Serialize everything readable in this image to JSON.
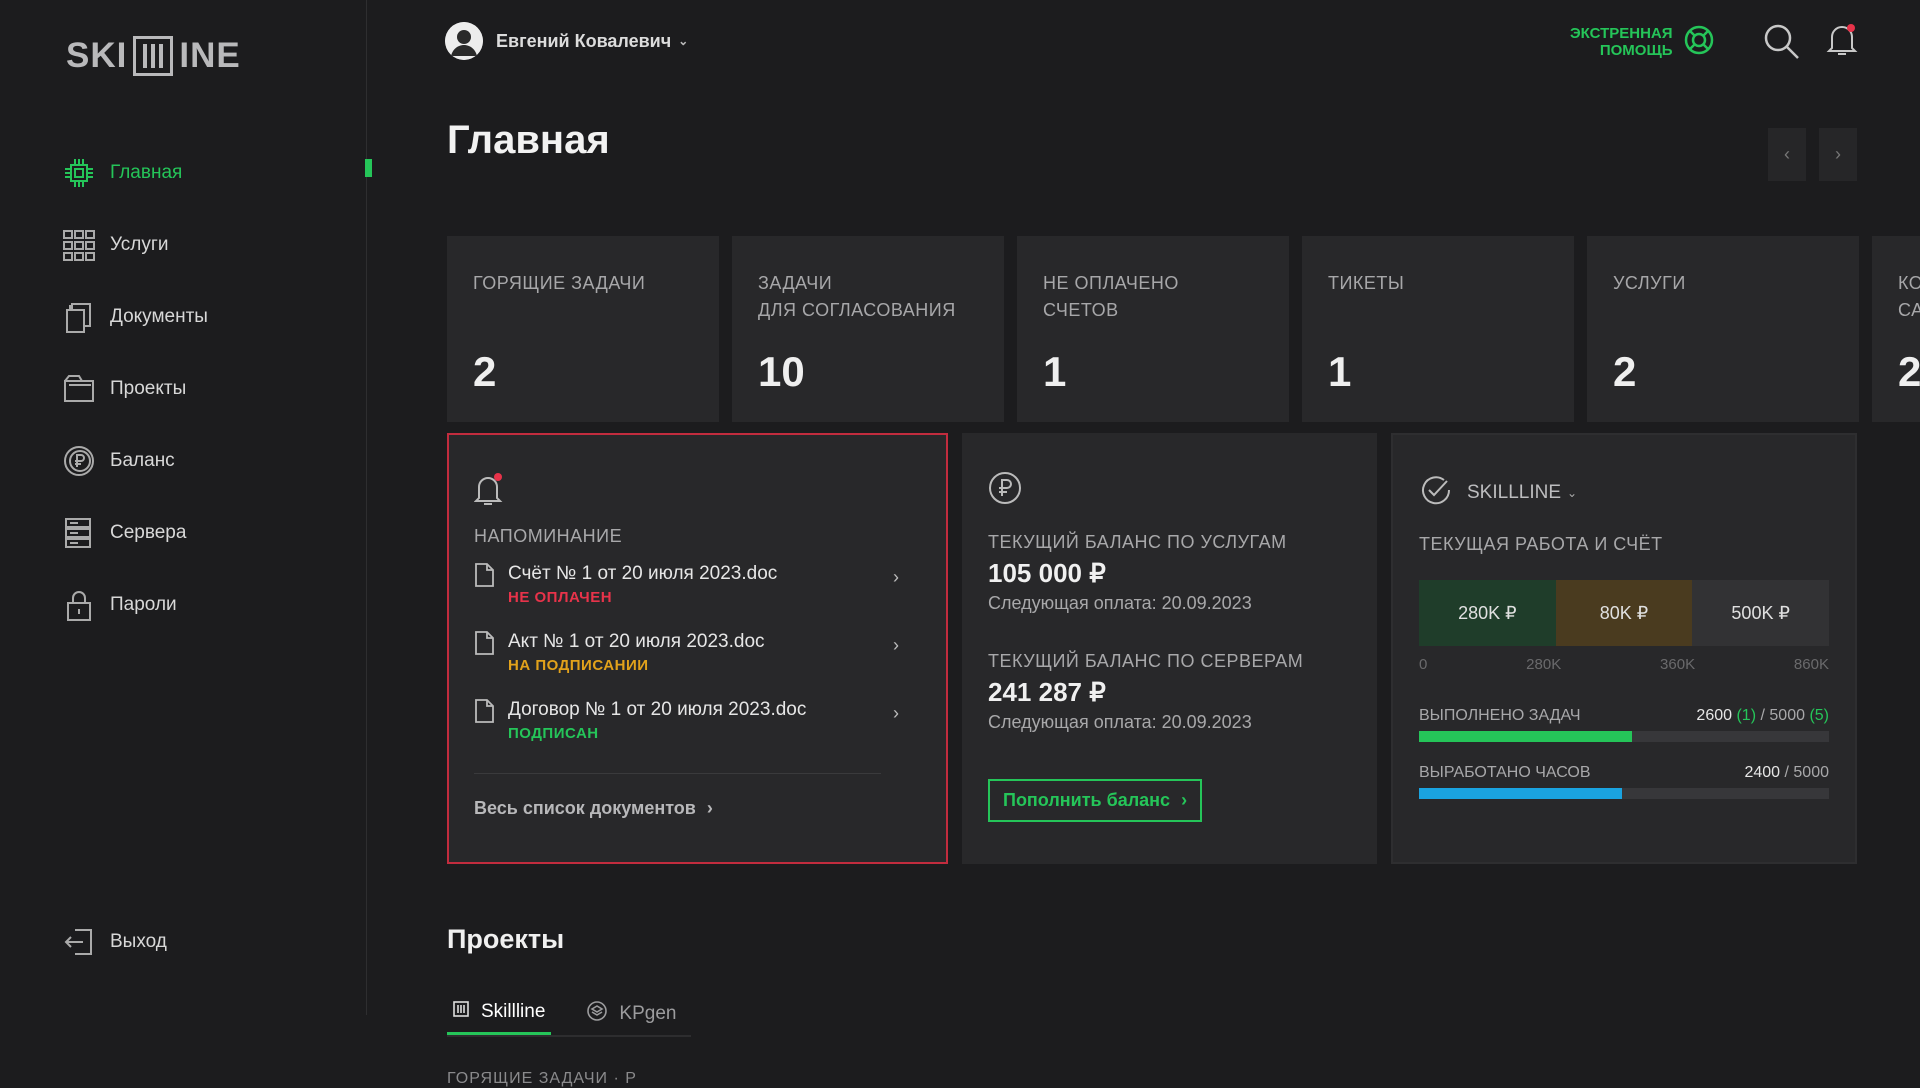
{
  "app": {
    "logo": "SKI",
    "logo_tail": "INE"
  },
  "sidebar": {
    "items": [
      {
        "label": "Главная",
        "icon": "chip-icon",
        "active": true
      },
      {
        "label": "Услуги",
        "icon": "grid-icon"
      },
      {
        "label": "Документы",
        "icon": "documents-icon"
      },
      {
        "label": "Проекты",
        "icon": "folder-icon"
      },
      {
        "label": "Баланс",
        "icon": "ruble-coin-icon"
      },
      {
        "label": "Сервера",
        "icon": "server-icon"
      },
      {
        "label": "Пароли",
        "icon": "lock-icon"
      }
    ],
    "logout": "Выход"
  },
  "header": {
    "user_name": "Евгений Ковалевич",
    "emergency_line1": "ЭКСТРЕННАЯ",
    "emergency_line2": "ПОМОЩЬ"
  },
  "page": {
    "title": "Главная",
    "prev": "‹",
    "next": "›"
  },
  "stats": [
    {
      "label1": "ГОРЯЩИЕ ЗАДАЧИ",
      "label2": "",
      "value": "2"
    },
    {
      "label1": "ЗАДАЧИ",
      "label2": "ДЛЯ СОГЛАСОВАНИЯ",
      "value": "10"
    },
    {
      "label1": "НЕ ОПЛАЧЕНО",
      "label2": "СЧЕТОВ",
      "value": "1"
    },
    {
      "label1": "ТИКЕТЫ",
      "label2": "",
      "value": "1"
    },
    {
      "label1": "УСЛУГИ",
      "label2": "",
      "value": "2"
    },
    {
      "label1": "КО",
      "label2": "СА",
      "value": "2"
    }
  ],
  "reminder": {
    "title": "НАПОМИНАНИЕ",
    "docs": [
      {
        "name": "Счёт № 1 от 20 июля 2023.doc",
        "status": "НЕ ОПЛАЧЕН",
        "color": "#e8334a"
      },
      {
        "name": "Акт № 1 от 20 июля 2023.doc",
        "status": "НА ПОДПИСАНИИ",
        "color": "#e2a21b"
      },
      {
        "name": "Договор № 1 от 20 июля 2023.doc",
        "status": "ПОДПИСАН",
        "color": "#25c559"
      }
    ],
    "all_docs": "Весь список документов"
  },
  "balance": {
    "services_title": "ТЕКУЩИЙ БАЛАНС ПО УСЛУГАМ",
    "services_amount": "105 000 ₽",
    "services_next": "Следующая оплата: 20.09.2023",
    "servers_title": "ТЕКУЩИЙ БАЛАНС ПО СЕРВЕРАМ",
    "servers_amount": "241 287 ₽",
    "servers_next": "Следующая оплата: 20.09.2023",
    "topup": "Пополнить баланс"
  },
  "work": {
    "company": "SKILLLINE",
    "title": "ТЕКУЩАЯ РАБОТА И СЧЁТ",
    "segments": [
      {
        "label": "280K ₽",
        "color": "#1f3d2a",
        "share": 280
      },
      {
        "label": "80K ₽",
        "color": "#4a3b1f",
        "share": 80
      },
      {
        "label": "500K ₽",
        "color": "#323234",
        "share": 500
      }
    ],
    "scale": [
      "0",
      "280K",
      "360K",
      "860K"
    ],
    "tasks_label": "ВЫПОЛНЕНО ЗАДАЧ",
    "tasks_done": "2600",
    "tasks_done_count": "(1)",
    "tasks_sep": "/",
    "tasks_total": "5000",
    "tasks_total_count": "(5)",
    "tasks_fraction": 0.52,
    "hours_label": "ВЫРАБОТАНО ЧАСОВ",
    "hours_done": "2400",
    "hours_sep": "/",
    "hours_total": "5000",
    "hours_fraction": 0.495,
    "tasks_color": "#25c559",
    "hours_color": "#1aa3e0"
  },
  "projects": {
    "title": "Проекты",
    "tabs": [
      {
        "label": "Skillline",
        "active": true
      },
      {
        "label": "KPgen"
      }
    ],
    "cut_text": "ГОРЯЩИЕ ЗАДАЧИ · Р"
  }
}
